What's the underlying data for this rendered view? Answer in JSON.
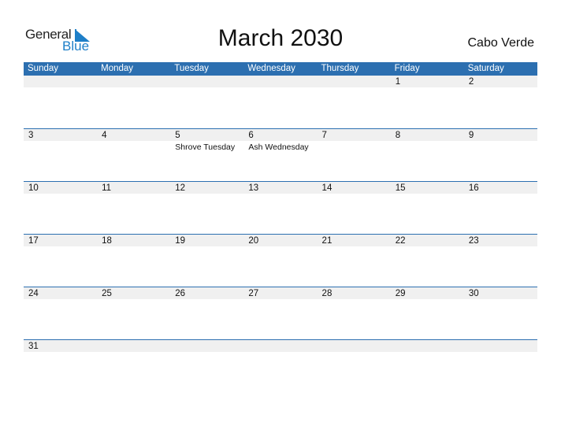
{
  "logo": {
    "general": "General",
    "blue": "Blue"
  },
  "title": "March 2030",
  "country": "Cabo Verde",
  "colors": {
    "header": "#2c6fb0",
    "band": "#f0f0f0",
    "brand": "#1e7fc8"
  },
  "weekdays": [
    "Sunday",
    "Monday",
    "Tuesday",
    "Wednesday",
    "Thursday",
    "Friday",
    "Saturday"
  ],
  "weeks": [
    [
      {
        "day": ""
      },
      {
        "day": ""
      },
      {
        "day": ""
      },
      {
        "day": ""
      },
      {
        "day": ""
      },
      {
        "day": "1"
      },
      {
        "day": "2"
      }
    ],
    [
      {
        "day": "3"
      },
      {
        "day": "4"
      },
      {
        "day": "5",
        "event": "Shrove Tuesday"
      },
      {
        "day": "6",
        "event": "Ash Wednesday"
      },
      {
        "day": "7"
      },
      {
        "day": "8"
      },
      {
        "day": "9"
      }
    ],
    [
      {
        "day": "10"
      },
      {
        "day": "11"
      },
      {
        "day": "12"
      },
      {
        "day": "13"
      },
      {
        "day": "14"
      },
      {
        "day": "15"
      },
      {
        "day": "16"
      }
    ],
    [
      {
        "day": "17"
      },
      {
        "day": "18"
      },
      {
        "day": "19"
      },
      {
        "day": "20"
      },
      {
        "day": "21"
      },
      {
        "day": "22"
      },
      {
        "day": "23"
      }
    ],
    [
      {
        "day": "24"
      },
      {
        "day": "25"
      },
      {
        "day": "26"
      },
      {
        "day": "27"
      },
      {
        "day": "28"
      },
      {
        "day": "29"
      },
      {
        "day": "30"
      }
    ],
    [
      {
        "day": "31"
      },
      {
        "day": ""
      },
      {
        "day": ""
      },
      {
        "day": ""
      },
      {
        "day": ""
      },
      {
        "day": ""
      },
      {
        "day": ""
      }
    ]
  ]
}
